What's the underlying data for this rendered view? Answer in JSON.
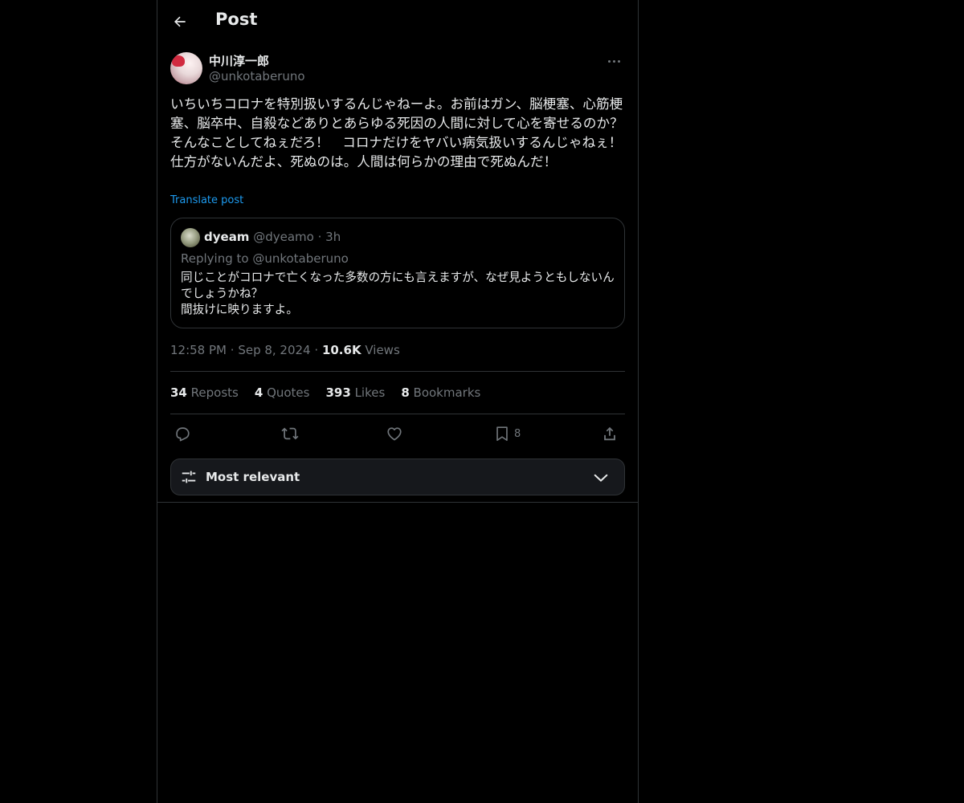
{
  "header": {
    "title": "Post"
  },
  "post": {
    "author_name": "中川淳一郎",
    "author_handle": "@unkotaberuno",
    "text": "いちいちコロナを特別扱いするんじゃねーよ。お前はガン、脳梗塞、心筋梗塞、脳卒中、自殺などありとあらゆる死因の人間に対して心を寄せるのか？　そんなことしてねぇだろ！　コロナだけをヤバい病気扱いするんじゃねぇ！　仕方がないんだよ、死ぬのは。人間は何らかの理由で死ぬんだ！",
    "translate_label": "Translate post",
    "time": "12:58 PM",
    "date": "Sep 8, 2024",
    "views_count": "10.6K",
    "views_label": "Views"
  },
  "quote": {
    "name": "dyeam",
    "handle": "@dyeamo",
    "time": "3h",
    "replying_to": "Replying to @unkotaberuno",
    "text": "同じことがコロナで亡くなった多数の方にも言えますが、なぜ見ようともしないんでしょうかね？\n間抜けに映りますよ。"
  },
  "stats": [
    {
      "count": "34",
      "label": "Reposts"
    },
    {
      "count": "4",
      "label": "Quotes"
    },
    {
      "count": "393",
      "label": "Likes"
    },
    {
      "count": "8",
      "label": "Bookmarks"
    }
  ],
  "actions": {
    "bookmark_count": "8",
    "icons": [
      "reply-icon",
      "repost-icon",
      "like-icon",
      "bookmark-icon",
      "share-icon"
    ]
  },
  "sort": {
    "label": "Most relevant"
  },
  "colors": {
    "background": "#000000",
    "text": "#e7e9ea",
    "muted": "#71767b",
    "link": "#1d9bf0",
    "border": "#2f3336"
  }
}
